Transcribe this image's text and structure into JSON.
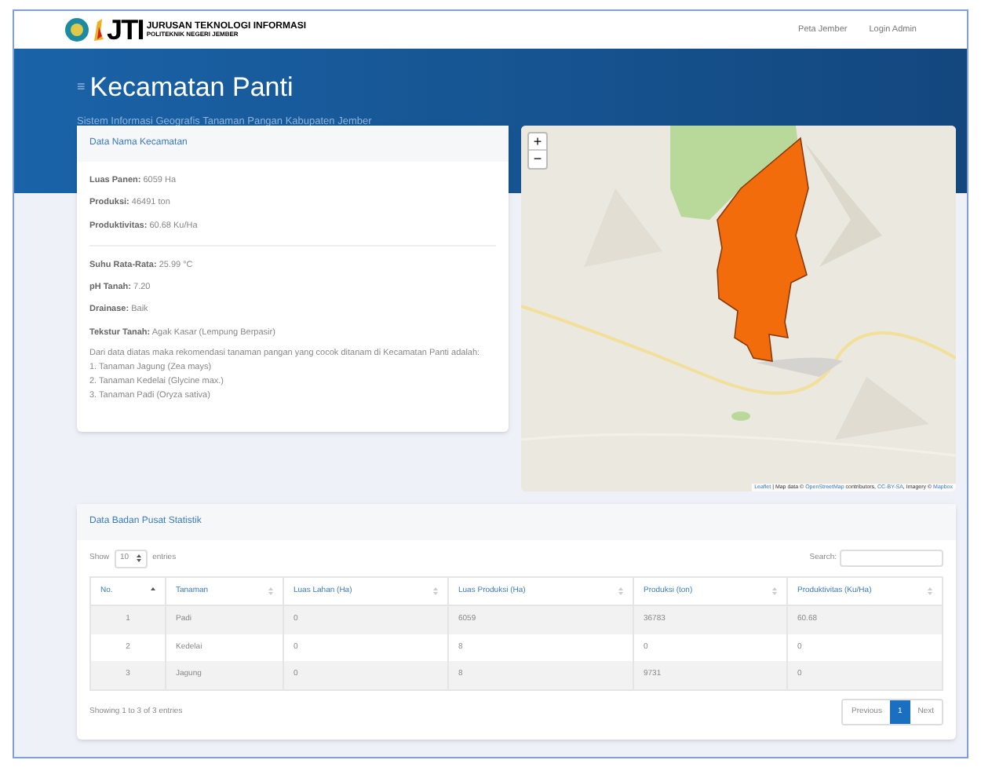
{
  "navbar": {
    "logo": {
      "mark": "JTI",
      "line_1": "JURUSAN TEKNOLOGI INFORMASI",
      "line_2": "POLITEKNIK NEGERI JEMBER"
    },
    "links": [
      "Peta Jember",
      "Login Admin"
    ]
  },
  "header": {
    "icon": "≡",
    "title": "Kecamatan Panti",
    "subtitle": "Sistem Informasi Geografis Tanaman Pangan Kabupaten Jember"
  },
  "info_card": {
    "title": "Data Nama Kecamatan",
    "group_1": [
      {
        "label": "Luas Panen:",
        "value": "6059 Ha"
      },
      {
        "label": "Produksi:",
        "value": "46491 ton"
      },
      {
        "label": "Produktivitas:",
        "value": "60.68 Ku/Ha"
      }
    ],
    "group_2": [
      {
        "label": "Suhu Rata-Rata:",
        "value": "25.99 °C"
      },
      {
        "label": "pH Tanah:",
        "value": "7.20"
      },
      {
        "label": "Drainase:",
        "value": "Baik"
      },
      {
        "label": "Tekstur Tanah:",
        "value": "Agak Kasar (Lempung Berpasir)"
      }
    ],
    "recommendation": "Dari data diatas maka rekomendasi tanaman pangan yang cocok ditanam di Kecamatan Panti adalah:",
    "list": [
      "1. Tanaman Jagung (Zea mays)",
      "2. Tanaman Kedelai (Glycine max.)",
      "3. Tanaman Padi (Oryza sativa)"
    ]
  },
  "map": {
    "zoom_in": "+",
    "zoom_out": "−",
    "attribution": [
      {
        "text": "Leaflet",
        "link": true
      },
      {
        "text": " | Map data © ",
        "link": false
      },
      {
        "text": "OpenStreetMap",
        "link": true
      },
      {
        "text": " contributors, ",
        "link": false
      },
      {
        "text": "CC-BY-SA",
        "link": true
      },
      {
        "text": ", Imagery © ",
        "link": false
      },
      {
        "text": "Mapbox",
        "link": true
      }
    ]
  },
  "table_card": {
    "title": "Data Badan Pusat Statistik",
    "show_label": "Show",
    "page_size": "10",
    "entries_label": "entries",
    "search_label": "Search:",
    "columns": [
      {
        "label": "No.",
        "sorted": true
      },
      {
        "label": "Tanaman",
        "sorted": false
      },
      {
        "label": "Luas Lahan (Ha)",
        "sorted": false
      },
      {
        "label": "Luas Produksi (Ha)",
        "sorted": false
      },
      {
        "label": "Produksi (ton)",
        "sorted": false
      },
      {
        "label": "Produktivitas (Ku/Ha)",
        "sorted": false
      }
    ],
    "rows": [
      [
        "1",
        "Padi",
        "0",
        "6059",
        "36783",
        "60.68"
      ],
      [
        "2",
        "Kedelai",
        "0",
        "8",
        "0",
        "0"
      ],
      [
        "3",
        "Jagung",
        "0",
        "8",
        "9731",
        "0"
      ]
    ],
    "info": "Showing 1 to 3 of 3 entries",
    "pagination": [
      {
        "label": "Previous",
        "selected": false
      },
      {
        "label": "1",
        "selected": true
      },
      {
        "label": "Next",
        "selected": false
      }
    ]
  }
}
